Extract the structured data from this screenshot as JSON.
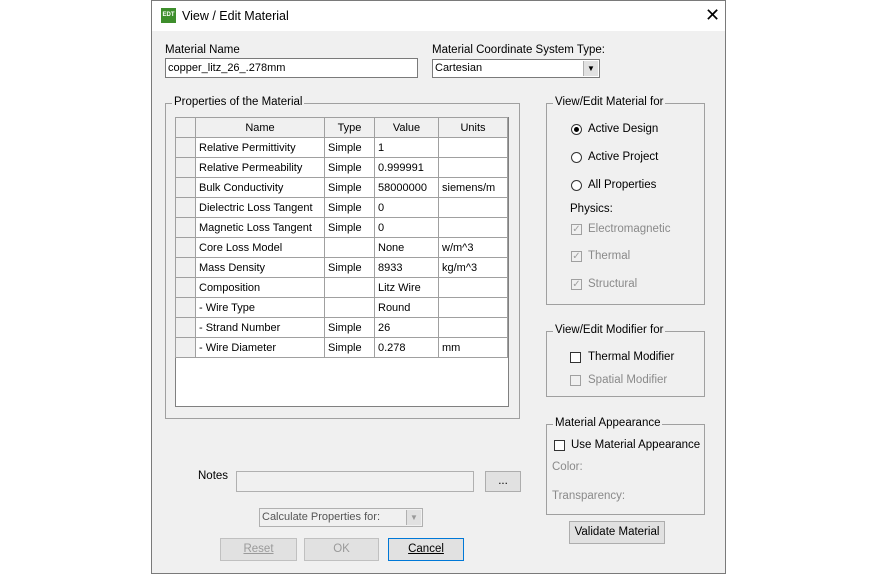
{
  "window": {
    "title": "View / Edit Material",
    "icon_text": "EDT"
  },
  "material_name": {
    "label": "Material Name",
    "value": "copper_litz_26_.278mm"
  },
  "coord_system": {
    "label": "Material Coordinate System Type:",
    "value": "Cartesian"
  },
  "properties": {
    "caption": "Properties of the Material",
    "columns": [
      "Name",
      "Type",
      "Value",
      "Units"
    ],
    "rows": [
      [
        "Relative Permittivity",
        "Simple",
        "1",
        ""
      ],
      [
        "Relative Permeability",
        "Simple",
        "0.999991",
        ""
      ],
      [
        "Bulk Conductivity",
        "Simple",
        "58000000",
        "siemens/m"
      ],
      [
        "Dielectric Loss Tangent",
        "Simple",
        "0",
        ""
      ],
      [
        "Magnetic Loss Tangent",
        "Simple",
        "0",
        ""
      ],
      [
        "Core Loss Model",
        "",
        "None",
        "w/m^3"
      ],
      [
        "Mass Density",
        "Simple",
        "8933",
        "kg/m^3"
      ],
      [
        "Composition",
        "",
        "Litz Wire",
        ""
      ],
      [
        "- Wire Type",
        "",
        "Round",
        ""
      ],
      [
        "- Strand Number",
        "Simple",
        "26",
        ""
      ],
      [
        "- Wire Diameter",
        "Simple",
        "0.278",
        "mm"
      ]
    ]
  },
  "view_edit_for": {
    "caption": "View/Edit Material for",
    "options": [
      "Active Design",
      "Active Project",
      "All Properties"
    ],
    "selected": "Active Design",
    "physics_label": "Physics:",
    "physics": [
      "Electromagnetic",
      "Thermal",
      "Structural"
    ]
  },
  "modifier": {
    "caption": "View/Edit Modifier for",
    "thermal": "Thermal Modifier",
    "spatial": "Spatial Modifier"
  },
  "appearance": {
    "caption": "Material Appearance",
    "use": "Use Material Appearance",
    "color": "Color:",
    "transparency": "Transparency:"
  },
  "notes": {
    "label": "Notes",
    "value": "",
    "browse": "..."
  },
  "calc": {
    "value": "Calculate Properties for:"
  },
  "buttons": {
    "validate": "Validate Material",
    "reset": "Reset",
    "ok": "OK",
    "cancel": "Cancel"
  }
}
